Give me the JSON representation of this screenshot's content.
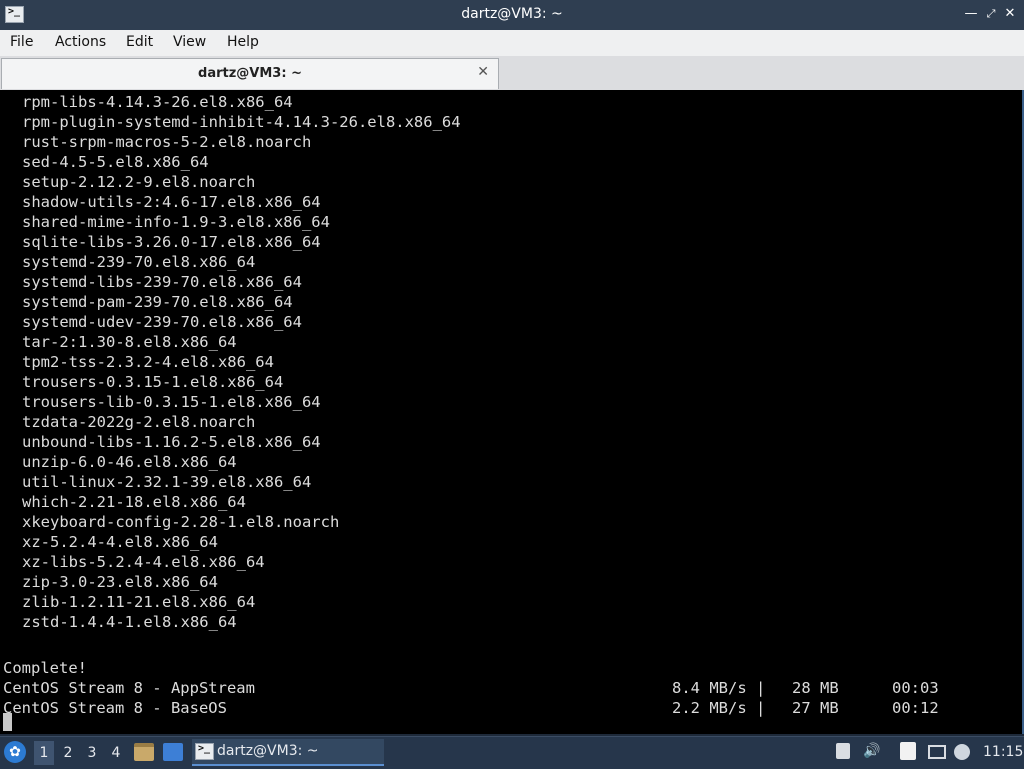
{
  "window": {
    "title": "dartz@VM3: ~",
    "app_icon": "terminal-icon",
    "buttons": [
      "minimize-icon",
      "maximize-icon",
      "close-icon"
    ]
  },
  "menu": {
    "items": [
      "File",
      "Actions",
      "Edit",
      "View",
      "Help"
    ]
  },
  "tab": {
    "label": "dartz@VM3: ~",
    "close_icon": "close-icon"
  },
  "terminal": {
    "packages": [
      "rpm-libs-4.14.3-26.el8.x86_64",
      "rpm-plugin-systemd-inhibit-4.14.3-26.el8.x86_64",
      "rust-srpm-macros-5-2.el8.noarch",
      "sed-4.5-5.el8.x86_64",
      "setup-2.12.2-9.el8.noarch",
      "shadow-utils-2:4.6-17.el8.x86_64",
      "shared-mime-info-1.9-3.el8.x86_64",
      "sqlite-libs-3.26.0-17.el8.x86_64",
      "systemd-239-70.el8.x86_64",
      "systemd-libs-239-70.el8.x86_64",
      "systemd-pam-239-70.el8.x86_64",
      "systemd-udev-239-70.el8.x86_64",
      "tar-2:1.30-8.el8.x86_64",
      "tpm2-tss-2.3.2-4.el8.x86_64",
      "trousers-0.3.15-1.el8.x86_64",
      "trousers-lib-0.3.15-1.el8.x86_64",
      "tzdata-2022g-2.el8.noarch",
      "unbound-libs-1.16.2-5.el8.x86_64",
      "unzip-6.0-46.el8.x86_64",
      "util-linux-2.32.1-39.el8.x86_64",
      "which-2.21-18.el8.x86_64",
      "xkeyboard-config-2.28-1.el8.noarch",
      "xz-5.2.4-4.el8.x86_64",
      "xz-libs-5.2.4-4.el8.x86_64",
      "zip-3.0-23.el8.x86_64",
      "zlib-1.2.11-21.el8.x86_64",
      "zstd-1.4.4-1.el8.x86_64"
    ],
    "complete": "Complete!",
    "repos": [
      {
        "name": "CentOS Stream 8 - AppStream",
        "speed": "8.4 MB/s |",
        "size": "28 MB",
        "time": "00:03"
      },
      {
        "name": "CentOS Stream 8 - BaseOS",
        "speed": "2.2 MB/s |",
        "size": "27 MB",
        "time": "00:12"
      }
    ]
  },
  "taskbar": {
    "start_icon": "start-menu-icon",
    "workspaces": [
      "1",
      "2",
      "3",
      "4"
    ],
    "active_workspace": "1",
    "quicklaunch": [
      "file-manager-icon",
      "desktop-icon"
    ],
    "task_label": "dartz@VM3: ~",
    "tray_icons": [
      "clipboard-icon",
      "volume-icon",
      "notes-icon",
      "network-icon",
      "update-icon"
    ],
    "clock": "11:15"
  },
  "colors": {
    "titlebar": "#2f3e51",
    "terminal_bg": "#000000",
    "terminal_fg": "#dcdcdc",
    "taskbar": "#26364b"
  }
}
